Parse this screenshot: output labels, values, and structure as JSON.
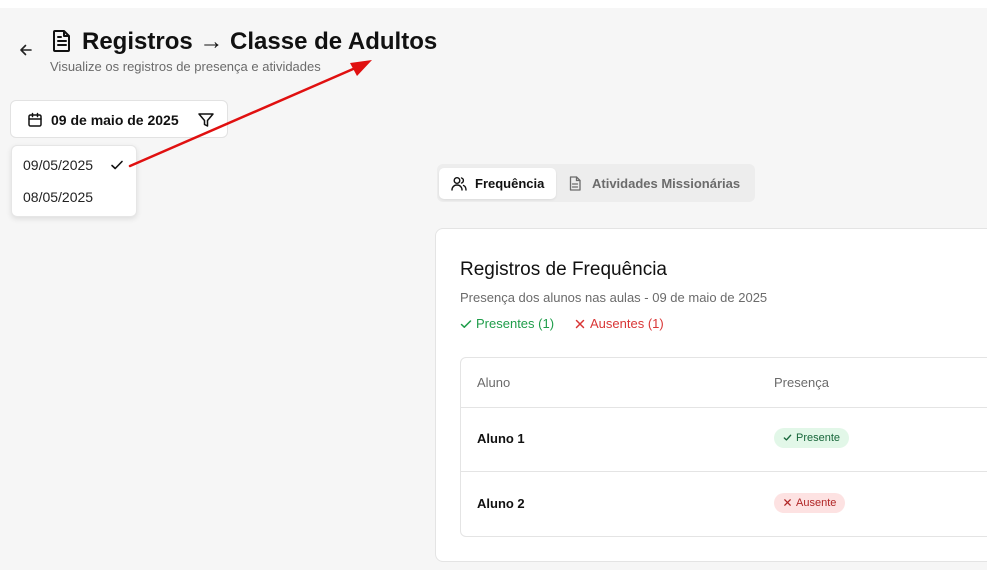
{
  "header": {
    "back_icon": "arrow-left-icon",
    "title_icon": "file-text-icon",
    "title": "Registros → Classe de Adultos",
    "subtitle": "Visualize os registros de presença e atividades"
  },
  "date_filter": {
    "calendar_icon": "calendar-icon",
    "selected_label": "09 de maio de 2025",
    "filter_icon": "filter-icon",
    "options": [
      {
        "label": "09/05/2025",
        "selected": true
      },
      {
        "label": "08/05/2025",
        "selected": false
      }
    ]
  },
  "tabs": [
    {
      "label": "Frequência",
      "icon": "users-icon",
      "active": true
    },
    {
      "label": "Atividades Missionárias",
      "icon": "file-text-icon",
      "active": false
    }
  ],
  "attendance": {
    "title": "Registros de Frequência",
    "description": "Presença dos alunos nas aulas - 09 de maio de 2025",
    "present_summary": "Presentes (1)",
    "absent_summary": "Ausentes (1)",
    "columns": [
      "Aluno",
      "Presença"
    ],
    "rows": [
      {
        "name": "Aluno 1",
        "status": "Presente",
        "status_type": "present"
      },
      {
        "name": "Aluno 2",
        "status": "Ausente",
        "status_type": "absent"
      }
    ]
  },
  "colors": {
    "present_text": "#1f9d4a",
    "absent_text": "#d93636",
    "annotation_arrow": "#e01010"
  }
}
